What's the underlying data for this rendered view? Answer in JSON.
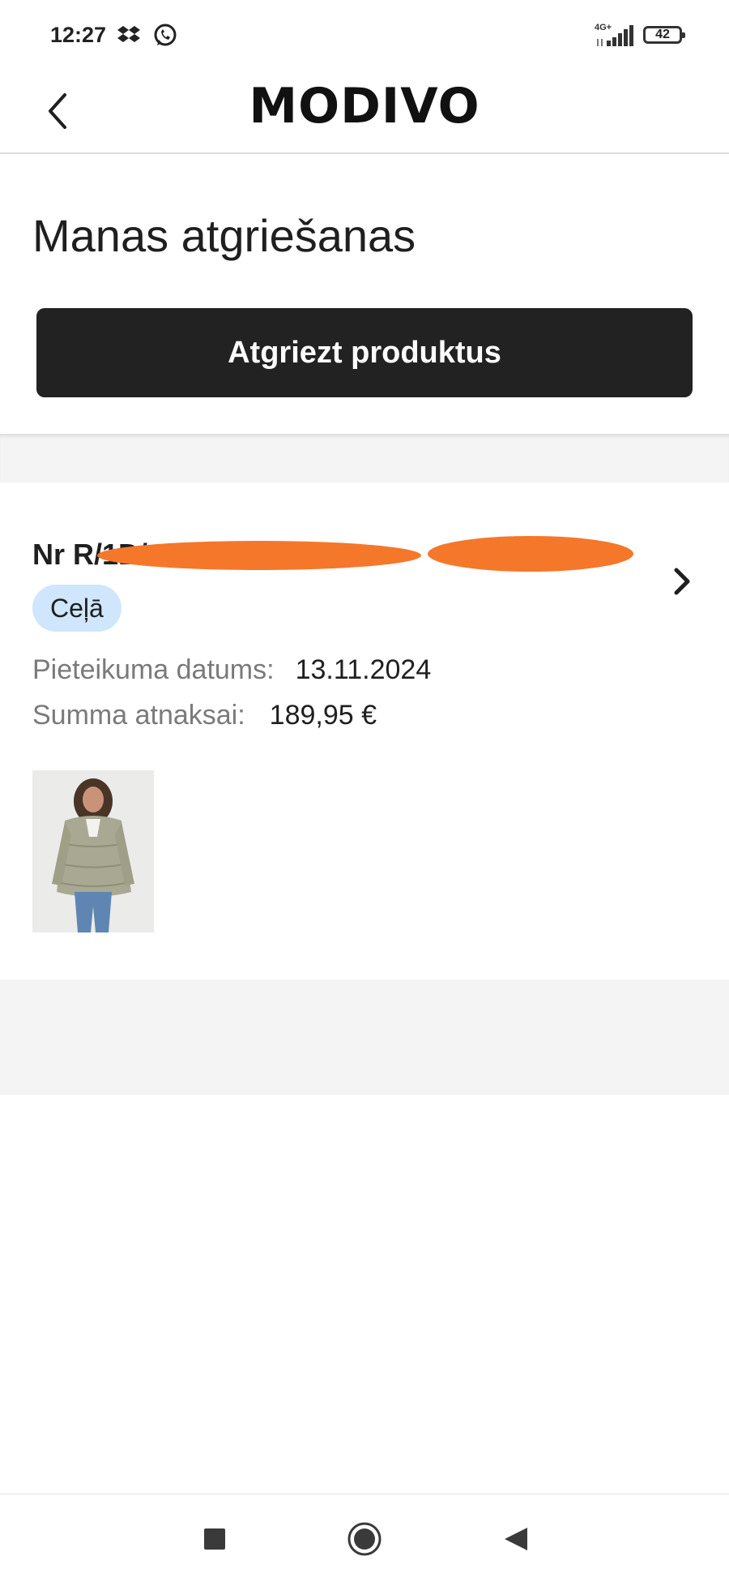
{
  "status_bar": {
    "time": "12:27",
    "network": "4G+",
    "battery": "42",
    "icons": [
      "dropbox-icon",
      "whatsapp-icon",
      "signal-icon",
      "battery-icon"
    ]
  },
  "header": {
    "back_icon": "chevron-left-icon",
    "logo": "MODIVO"
  },
  "page": {
    "title": "Manas atgriešanas",
    "return_button": "Atgriezt produktus"
  },
  "return_item": {
    "number": "Nr R/1D/",
    "status": "Ceļā",
    "date_label": "Pieteikuma datums:",
    "date_value": "13.11.2024",
    "amount_label": "Summa atnaksai:",
    "amount_value": "189,95 €",
    "product_image": "puffer-jacket-photo",
    "chevron": "chevron-right-icon"
  },
  "nav_bar": {
    "buttons": [
      "recent-apps-icon",
      "home-icon",
      "back-icon"
    ]
  },
  "colors": {
    "primary_button": "#222222",
    "badge_bg": "#cfe6fd",
    "redaction": "#f5772a",
    "band": "#f4f4f4"
  }
}
